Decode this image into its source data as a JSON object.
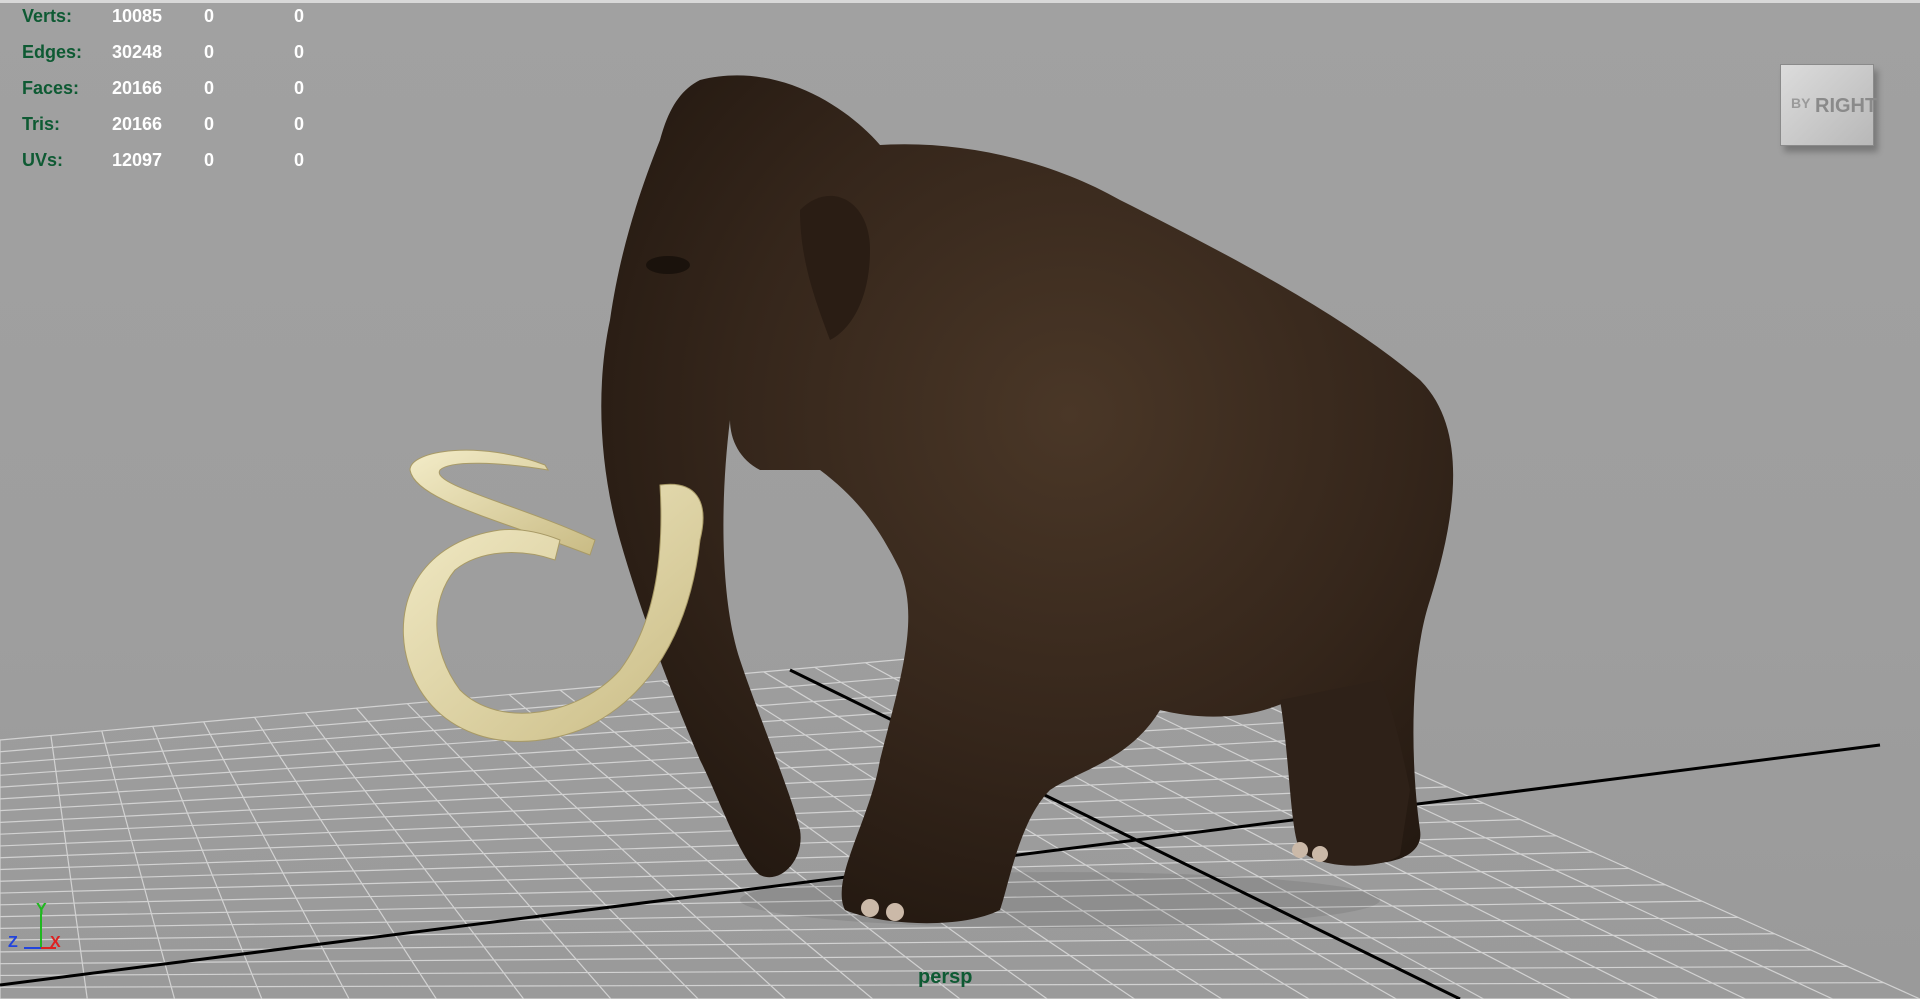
{
  "viewport": {
    "camera_name": "persp",
    "view_cube_label": "RIGHT",
    "view_cube_side_label": "ΒΥ",
    "axis": {
      "y": "Y",
      "z": "Z",
      "x": "X"
    }
  },
  "hud": {
    "rows": [
      {
        "label": "Verts:",
        "total": "10085",
        "selected": "0",
        "component": "0"
      },
      {
        "label": "Edges:",
        "total": "30248",
        "selected": "0",
        "component": "0"
      },
      {
        "label": "Faces:",
        "total": "20166",
        "selected": "0",
        "component": "0"
      },
      {
        "label": "Tris:",
        "total": "20166",
        "selected": "0",
        "component": "0"
      },
      {
        "label": "UVs:",
        "total": "12097",
        "selected": "0",
        "component": "0"
      }
    ]
  },
  "colors": {
    "viewport_bg": "#9d9d9d",
    "hud_label": "#0e5a33",
    "hud_value": "#ffffff",
    "grid_line": "#d2d2d2",
    "grid_axis": "#000000",
    "fur": "#3a2a1f",
    "tusk": "#e8deb0"
  },
  "icons": [
    "view-cube-icon",
    "axis-gizmo-icon"
  ]
}
